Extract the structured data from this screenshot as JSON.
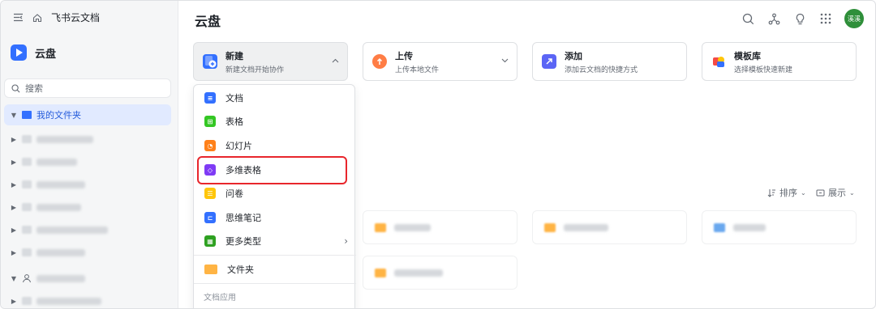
{
  "sidebar": {
    "brand": "飞书云文档",
    "app_name": "云盘",
    "search_placeholder": "搜索",
    "my_folder": "我的文件夹"
  },
  "header": {
    "title": "云盘",
    "avatar_text": "溪溪"
  },
  "cards": [
    {
      "title": "新建",
      "subtitle": "新建文档开始协作"
    },
    {
      "title": "上传",
      "subtitle": "上传本地文件"
    },
    {
      "title": "添加",
      "subtitle": "添加云文档的快捷方式"
    },
    {
      "title": "模板库",
      "subtitle": "选择模板快速新建"
    }
  ],
  "menu": {
    "items": [
      "文档",
      "表格",
      "幻灯片",
      "多维表格",
      "问卷",
      "思维笔记",
      "更多类型",
      "文件夹"
    ],
    "section": "文档应用"
  },
  "toolbar": {
    "sort": "排序",
    "view": "展示"
  },
  "colors": {
    "accent": "#3370ff",
    "highlight": "#e8262c"
  }
}
